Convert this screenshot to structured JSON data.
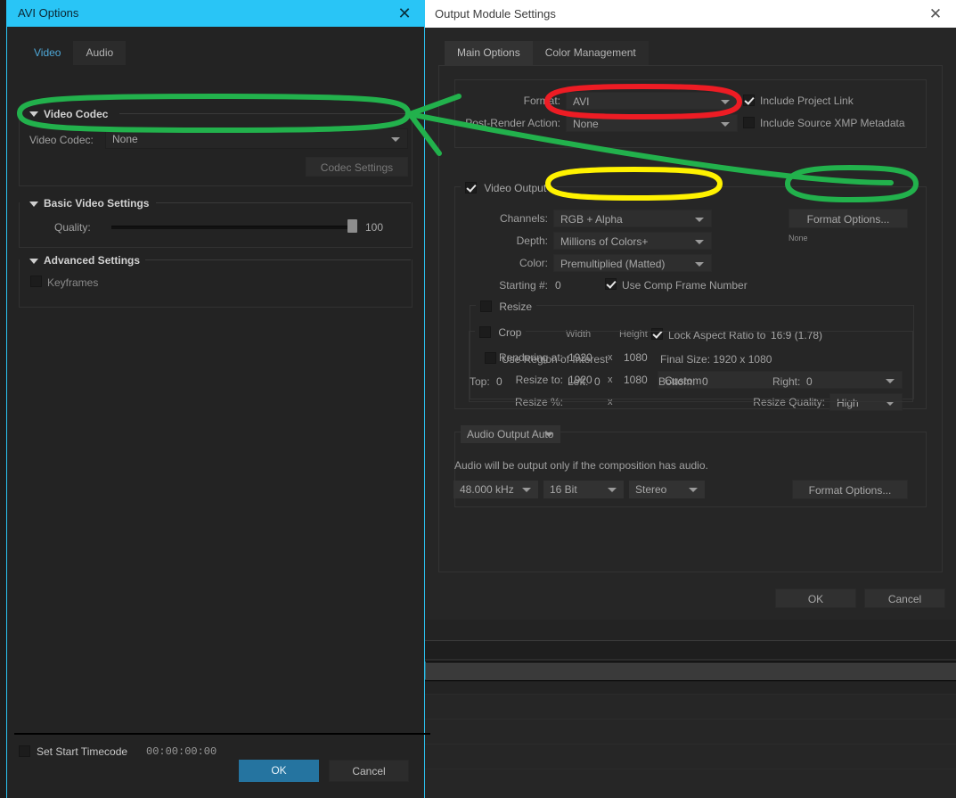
{
  "avi_dialog": {
    "title": "AVI Options",
    "close_icon": "close-icon",
    "tabs": [
      {
        "label": "Video",
        "active": true
      },
      {
        "label": "Audio",
        "active": false
      }
    ],
    "sections": {
      "video_codec": {
        "title": "Video Codec",
        "codec_label": "Video Codec:",
        "codec_value": "None",
        "codec_settings_button": "Codec Settings"
      },
      "basic_video_settings": {
        "title": "Basic Video Settings",
        "quality_label": "Quality:",
        "quality_value": "100"
      },
      "advanced_settings": {
        "title": "Advanced Settings",
        "keyframes_label": "Keyframes",
        "keyframes_checked": false
      }
    },
    "footer": {
      "set_start_timecode_label": "Set Start Timecode",
      "set_start_timecode_checked": false,
      "timecode_value": "00:00:00:00",
      "ok_label": "OK",
      "cancel_label": "Cancel"
    }
  },
  "output_module_dialog": {
    "title": "Output Module Settings",
    "close_icon": "close-icon",
    "tabs": [
      {
        "label": "Main Options",
        "active": true
      },
      {
        "label": "Color Management",
        "active": false
      }
    ],
    "format_group": {
      "format_label": "Format:",
      "format_value": "AVI",
      "post_render_label": "Post-Render Action:",
      "post_render_value": "None",
      "include_project_link_label": "Include Project Link",
      "include_project_link_checked": true,
      "include_xmp_label": "Include Source XMP Metadata",
      "include_xmp_checked": false
    },
    "video_output": {
      "title": "Video Output",
      "enabled": true,
      "channels_label": "Channels:",
      "channels_value": "RGB + Alpha",
      "depth_label": "Depth:",
      "depth_value": "Millions of Colors+",
      "color_label": "Color:",
      "color_value": "Premultiplied (Matted)",
      "starting_num_label": "Starting #:",
      "starting_num_value": "0",
      "use_comp_frame_label": "Use Comp Frame Number",
      "use_comp_frame_checked": true,
      "format_options_button": "Format Options...",
      "format_options_status": "None"
    },
    "resize": {
      "title": "Resize",
      "enabled": false,
      "width_header": "Width",
      "height_header": "Height",
      "lock_aspect_label": "Lock Aspect Ratio to",
      "lock_aspect_ratio": "16:9 (1.78)",
      "lock_aspect_checked": true,
      "rendering_at_label": "Rendering at:",
      "rendering_width": "1920",
      "rendering_height": "1080",
      "resize_to_label": "Resize to:",
      "resize_width": "1920",
      "resize_height": "1080",
      "resize_preset": "Custom",
      "resize_pct_label": "Resize %:",
      "resize_quality_label": "Resize Quality:",
      "resize_quality_value": "High",
      "x_symbol": "x"
    },
    "crop": {
      "title": "Crop",
      "enabled": false,
      "use_region_label": "Use Region of Interest",
      "use_region_checked": false,
      "final_size_label": "Final Size: 1920 x 1080",
      "top_label": "Top:",
      "top_value": "0",
      "left_label": "Left:",
      "left_value": "0",
      "bottom_label": "Bottom:",
      "bottom_value": "0",
      "right_label": "Right:",
      "right_value": "0"
    },
    "audio": {
      "mode_value": "Audio Output Auto",
      "note": "Audio will be output only if the composition has audio.",
      "sample_rate": "48.000 kHz",
      "bit_depth": "16 Bit",
      "channels": "Stereo",
      "format_options_button": "Format Options..."
    },
    "footer": {
      "ok_label": "OK",
      "cancel_label": "Cancel"
    }
  },
  "annotations": {
    "colors": {
      "green": "#22b14c",
      "red": "#ed1c24",
      "yellow": "#fff200"
    },
    "shapes": [
      {
        "name": "green-ellipse-video-codec",
        "color": "#22b14c"
      },
      {
        "name": "red-ellipse-format",
        "color": "#ed1c24"
      },
      {
        "name": "yellow-ellipse-channels",
        "color": "#fff200"
      },
      {
        "name": "green-ellipse-format-options",
        "color": "#22b14c"
      },
      {
        "name": "green-arrow",
        "color": "#22b14c"
      }
    ]
  }
}
